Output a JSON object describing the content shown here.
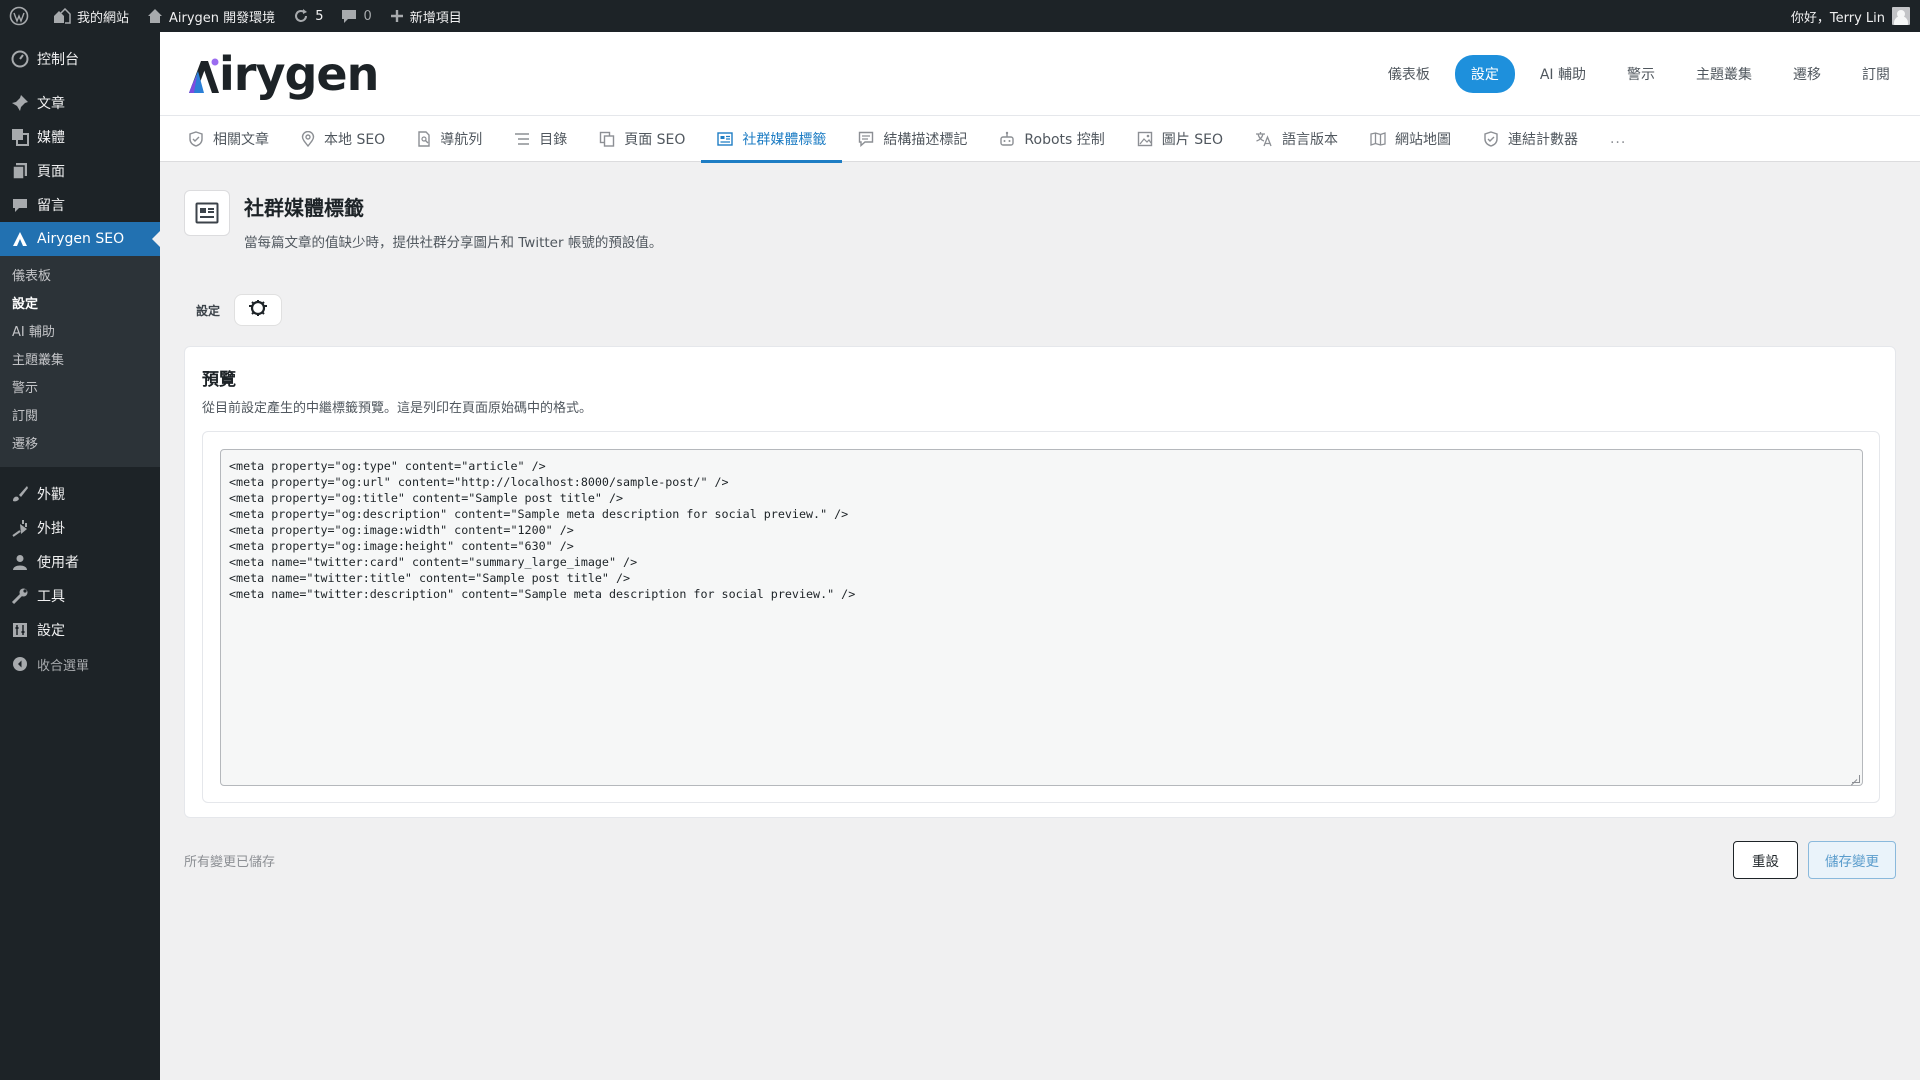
{
  "adminbar": {
    "wp_logo_icon": "wordpress-icon",
    "site_name": "我的網站",
    "env_name": "Airygen 開發環境",
    "updates_count": "5",
    "comments_count": "0",
    "new_item_label": "新增項目",
    "greeting": "你好，Terry Lin"
  },
  "sidebar": {
    "dashboard": "控制台",
    "posts": "文章",
    "media": "媒體",
    "pages": "頁面",
    "comments": "留言",
    "plugin": "Airygen SEO",
    "submenu": [
      "儀表板",
      "設定",
      "AI 輔助",
      "主題叢集",
      "警示",
      "訂閱",
      "遷移"
    ],
    "appearance": "外觀",
    "plugins": "外掛",
    "users": "使用者",
    "tools": "工具",
    "settings": "設定",
    "collapse": "收合選單"
  },
  "header": {
    "logo_text": "irygen",
    "nav": [
      "儀表板",
      "設定",
      "AI 輔助",
      "警示",
      "主題叢集",
      "遷移",
      "訂閱"
    ],
    "active_nav": "設定"
  },
  "tabs": {
    "items": [
      {
        "label": "相關文章",
        "icon": "shield-check-icon"
      },
      {
        "label": "本地 SEO",
        "icon": "map-pin-icon"
      },
      {
        "label": "導航列",
        "icon": "document-icon"
      },
      {
        "label": "目錄",
        "icon": "list-icon"
      },
      {
        "label": "頁面 SEO",
        "icon": "copy-icon"
      },
      {
        "label": "社群媒體標籤",
        "icon": "news-icon"
      },
      {
        "label": "結構描述標記",
        "icon": "comment-icon"
      },
      {
        "label": "Robots 控制",
        "icon": "robot-icon"
      },
      {
        "label": "圖片 SEO",
        "icon": "image-icon"
      },
      {
        "label": "語言版本",
        "icon": "translate-icon"
      },
      {
        "label": "網站地圖",
        "icon": "map-icon"
      },
      {
        "label": "連結計數器",
        "icon": "shield-check-icon"
      }
    ],
    "more": "...",
    "active": "社群媒體標籤"
  },
  "page": {
    "title": "社群媒體標籤",
    "description": "當每篇文章的值缺少時，提供社群分享圖片和 Twitter 帳號的預設值。",
    "settings_label": "設定"
  },
  "preview": {
    "title": "預覽",
    "description": "從目前設定產生的中繼標籤預覽。這是列印在頁面原始碼中的格式。",
    "code": "<meta property=\"og:type\" content=\"article\" />\n<meta property=\"og:url\" content=\"http://localhost:8000/sample-post/\" />\n<meta property=\"og:title\" content=\"Sample post title\" />\n<meta property=\"og:description\" content=\"Sample meta description for social preview.\" />\n<meta property=\"og:image:width\" content=\"1200\" />\n<meta property=\"og:image:height\" content=\"630\" />\n<meta name=\"twitter:card\" content=\"summary_large_image\" />\n<meta name=\"twitter:title\" content=\"Sample post title\" />\n<meta name=\"twitter:description\" content=\"Sample meta description for social preview.\" />"
  },
  "footer": {
    "status": "所有變更已儲存",
    "reset_label": "重設",
    "save_label": "儲存變更"
  },
  "colors": {
    "accent": "#1e90dc",
    "sidebar_bg": "#1d2327",
    "sidebar_current": "#2271b1"
  }
}
